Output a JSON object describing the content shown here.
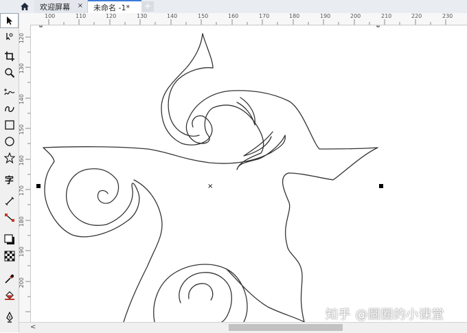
{
  "tabs": {
    "home_icon": "home-icon",
    "welcome_label": "欢迎屏幕",
    "welcome_close": "×",
    "document_label": "未命名 -1*",
    "add_tab": "+"
  },
  "toolbox": {
    "tools": [
      "pick-tool-icon",
      "shape-tool-icon",
      "crop-tool-icon",
      "zoom-tool-icon",
      "freehand-tool-icon",
      "artistic-media-icon",
      "rectangle-tool-icon",
      "ellipse-tool-icon",
      "polygon-tool-icon",
      "text-tool-icon",
      "parallel-dimension-icon",
      "connector-tool-icon",
      "drop-shadow-icon",
      "transparency-icon",
      "eyedropper-icon",
      "interactive-fill-icon",
      "smart-fill-icon"
    ],
    "text_tool_glyph": "字"
  },
  "ruler": {
    "horizontal_ticks": [
      "100",
      "110",
      "120",
      "130",
      "140",
      "150",
      "160",
      "170",
      "180",
      "190",
      "200",
      "210",
      "220",
      "230"
    ],
    "vertical_ticks": [
      "120",
      "130",
      "140",
      "150",
      "160",
      "170",
      "180",
      "190",
      "200"
    ]
  },
  "canvas": {
    "center_marker": "×"
  },
  "watermark": "知乎 @圆圈的小课堂",
  "colors": {
    "accent": "#3b7ad8",
    "outline": "#333333"
  }
}
